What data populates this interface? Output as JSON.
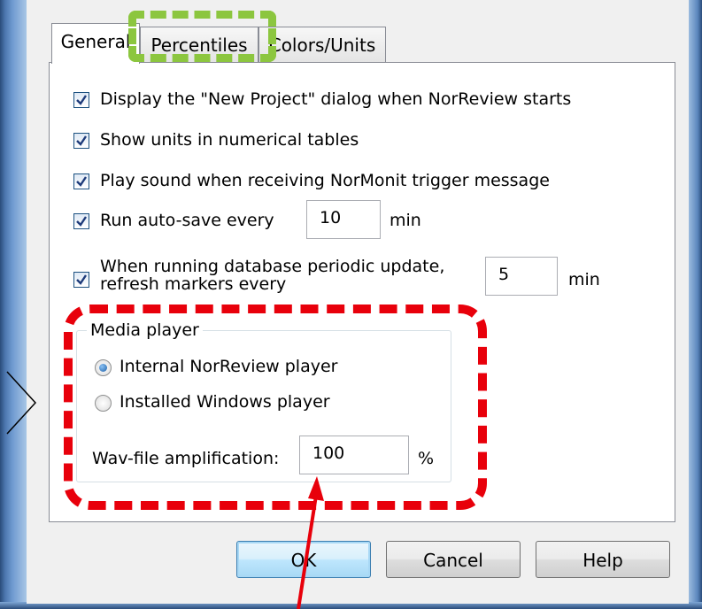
{
  "dialog": {
    "tabs": [
      {
        "label": "General",
        "active": true
      },
      {
        "label": "Percentiles",
        "active": false
      },
      {
        "label": "Colors/Units",
        "active": false
      }
    ],
    "options": {
      "show_new_project": {
        "label": "Display the \"New Project\" dialog when NorReview starts",
        "checked": true
      },
      "show_units": {
        "label": "Show units in numerical tables",
        "checked": true
      },
      "play_sound": {
        "label": "Play sound when receiving NorMonit trigger message",
        "checked": true
      },
      "autosave": {
        "label": "Run auto-save every",
        "checked": true,
        "value": "10",
        "unit": "min"
      },
      "refresh_markers": {
        "label_line1": "When running database periodic update,",
        "label_line2": "refresh markers every",
        "checked": true,
        "value": "5",
        "unit": "min"
      }
    },
    "media_player": {
      "title": "Media player",
      "options": [
        {
          "label": "Internal NorReview player",
          "selected": true
        },
        {
          "label": "Installed Windows player",
          "selected": false
        }
      ],
      "wav_label": "Wav-file amplification:",
      "wav_value": "100",
      "wav_unit": "%"
    },
    "buttons": {
      "ok": "OK",
      "cancel": "Cancel",
      "help": "Help"
    }
  },
  "annotations": {
    "green_color": "#8cc63f",
    "red_color": "#e8000b"
  }
}
